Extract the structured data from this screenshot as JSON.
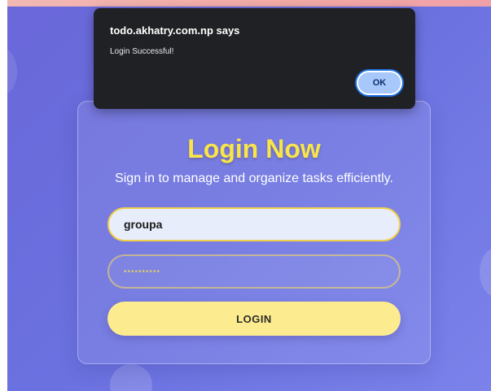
{
  "dialog": {
    "origin": "todo.akhatry.com.np says",
    "message": "Login Successful!",
    "ok_label": "OK"
  },
  "login": {
    "title": "Login Now",
    "subtitle": "Sign in to manage and organize tasks efficiently.",
    "username_value": "groupa",
    "password_value": "••••••••••",
    "button_label": "LOGIN"
  },
  "colors": {
    "background": "#6b72e0",
    "title": "#f9e54a",
    "button": "#fdec8f",
    "dialog": "#202124",
    "dialog_ok": "#a8c7fa"
  }
}
